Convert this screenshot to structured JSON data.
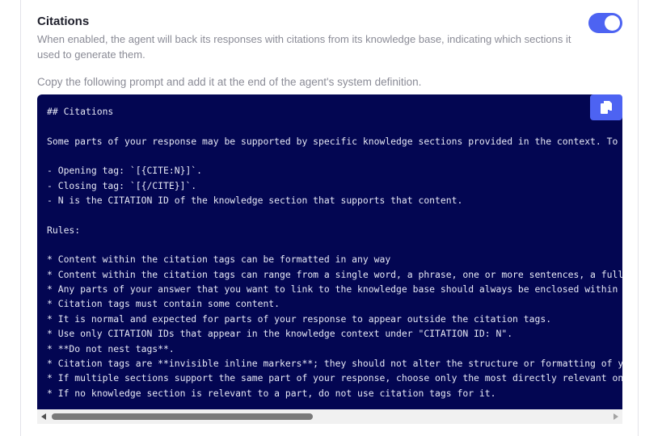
{
  "section": {
    "title": "Citations",
    "description": "When enabled, the agent will back its responses with citations from its knowledge base, indicating which sections it used to generate them.",
    "toggle_on": true,
    "accent_color": "#4d63f2"
  },
  "instructions": "Copy the following prompt and add it at the end of the agent's system definition.",
  "code": {
    "background_color": "#030652",
    "lines": [
      "## Citations",
      "",
      "Some parts of your response may be supported by specific knowledge sections provided in the context. To sh",
      "",
      "- Opening tag: `[{CITE:N}]`.",
      "- Closing tag: `[{/CITE}]`.",
      "- N is the CITATION ID of the knowledge section that supports that content.",
      "",
      "Rules:",
      "",
      "* Content within the citation tags can be formatted in any way",
      "* Content within the citation tags can range from a single word, a phrase, one or more sentences, a full p",
      "* Any parts of your answer that you want to link to the knowledge base should always be enclosed within an",
      "* Citation tags must contain some content.",
      "* It is normal and expected for parts of your response to appear outside the citation tags.",
      "* Use only CITATION IDs that appear in the knowledge context under \"CITATION ID: N\".",
      "* **Do not nest tags**.",
      "* Citation tags are **invisible inline markers**; they should not alter the structure or formatting of you",
      "* If multiple sections support the same part of your response, choose only the most directly relevant one",
      "* If no knowledge section is relevant to a part, do not use citation tags for it."
    ],
    "copy_icon": "copy-icon"
  },
  "scrollbar": {
    "position_fraction": 0.0,
    "visible_fraction": 0.47
  }
}
